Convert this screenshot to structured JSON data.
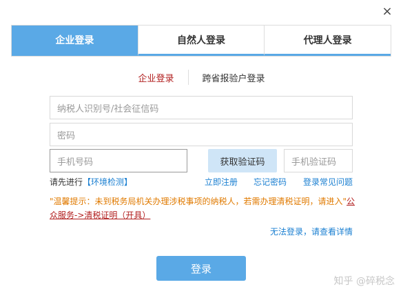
{
  "close_icon": "×",
  "tabs": [
    {
      "label": "企业登录",
      "active": true
    },
    {
      "label": "自然人登录",
      "active": false
    },
    {
      "label": "代理人登录",
      "active": false
    }
  ],
  "subtabs": [
    {
      "label": "企业登录",
      "active": true
    },
    {
      "label": "跨省报验户登录",
      "active": false
    }
  ],
  "form": {
    "taxpayer_id_placeholder": "纳税人识别号/社会征信码",
    "password_placeholder": "密码",
    "phone_placeholder": "手机号码",
    "get_code_label": "获取验证码",
    "code_placeholder": "手机验证码"
  },
  "links": {
    "prefix": "请先进行",
    "env_check": "【环境检测】",
    "register": "立即注册",
    "forgot_password": "忘记密码",
    "faq": "登录常见问题"
  },
  "tip": {
    "text": "\"温馨提示：未到税务局机关办理涉税事项的纳税人，若需办理清税证明，请进入\"",
    "service_link": "公众服务->清税证明（开具）"
  },
  "cant_login": "无法登录，请查看详情",
  "login_button": "登录",
  "watermark": "知乎 @碎税念",
  "colors": {
    "accent": "#5aa9e6",
    "link": "#1a7fd1",
    "warning": "#e07a00",
    "active_red": "#b11e1e"
  }
}
